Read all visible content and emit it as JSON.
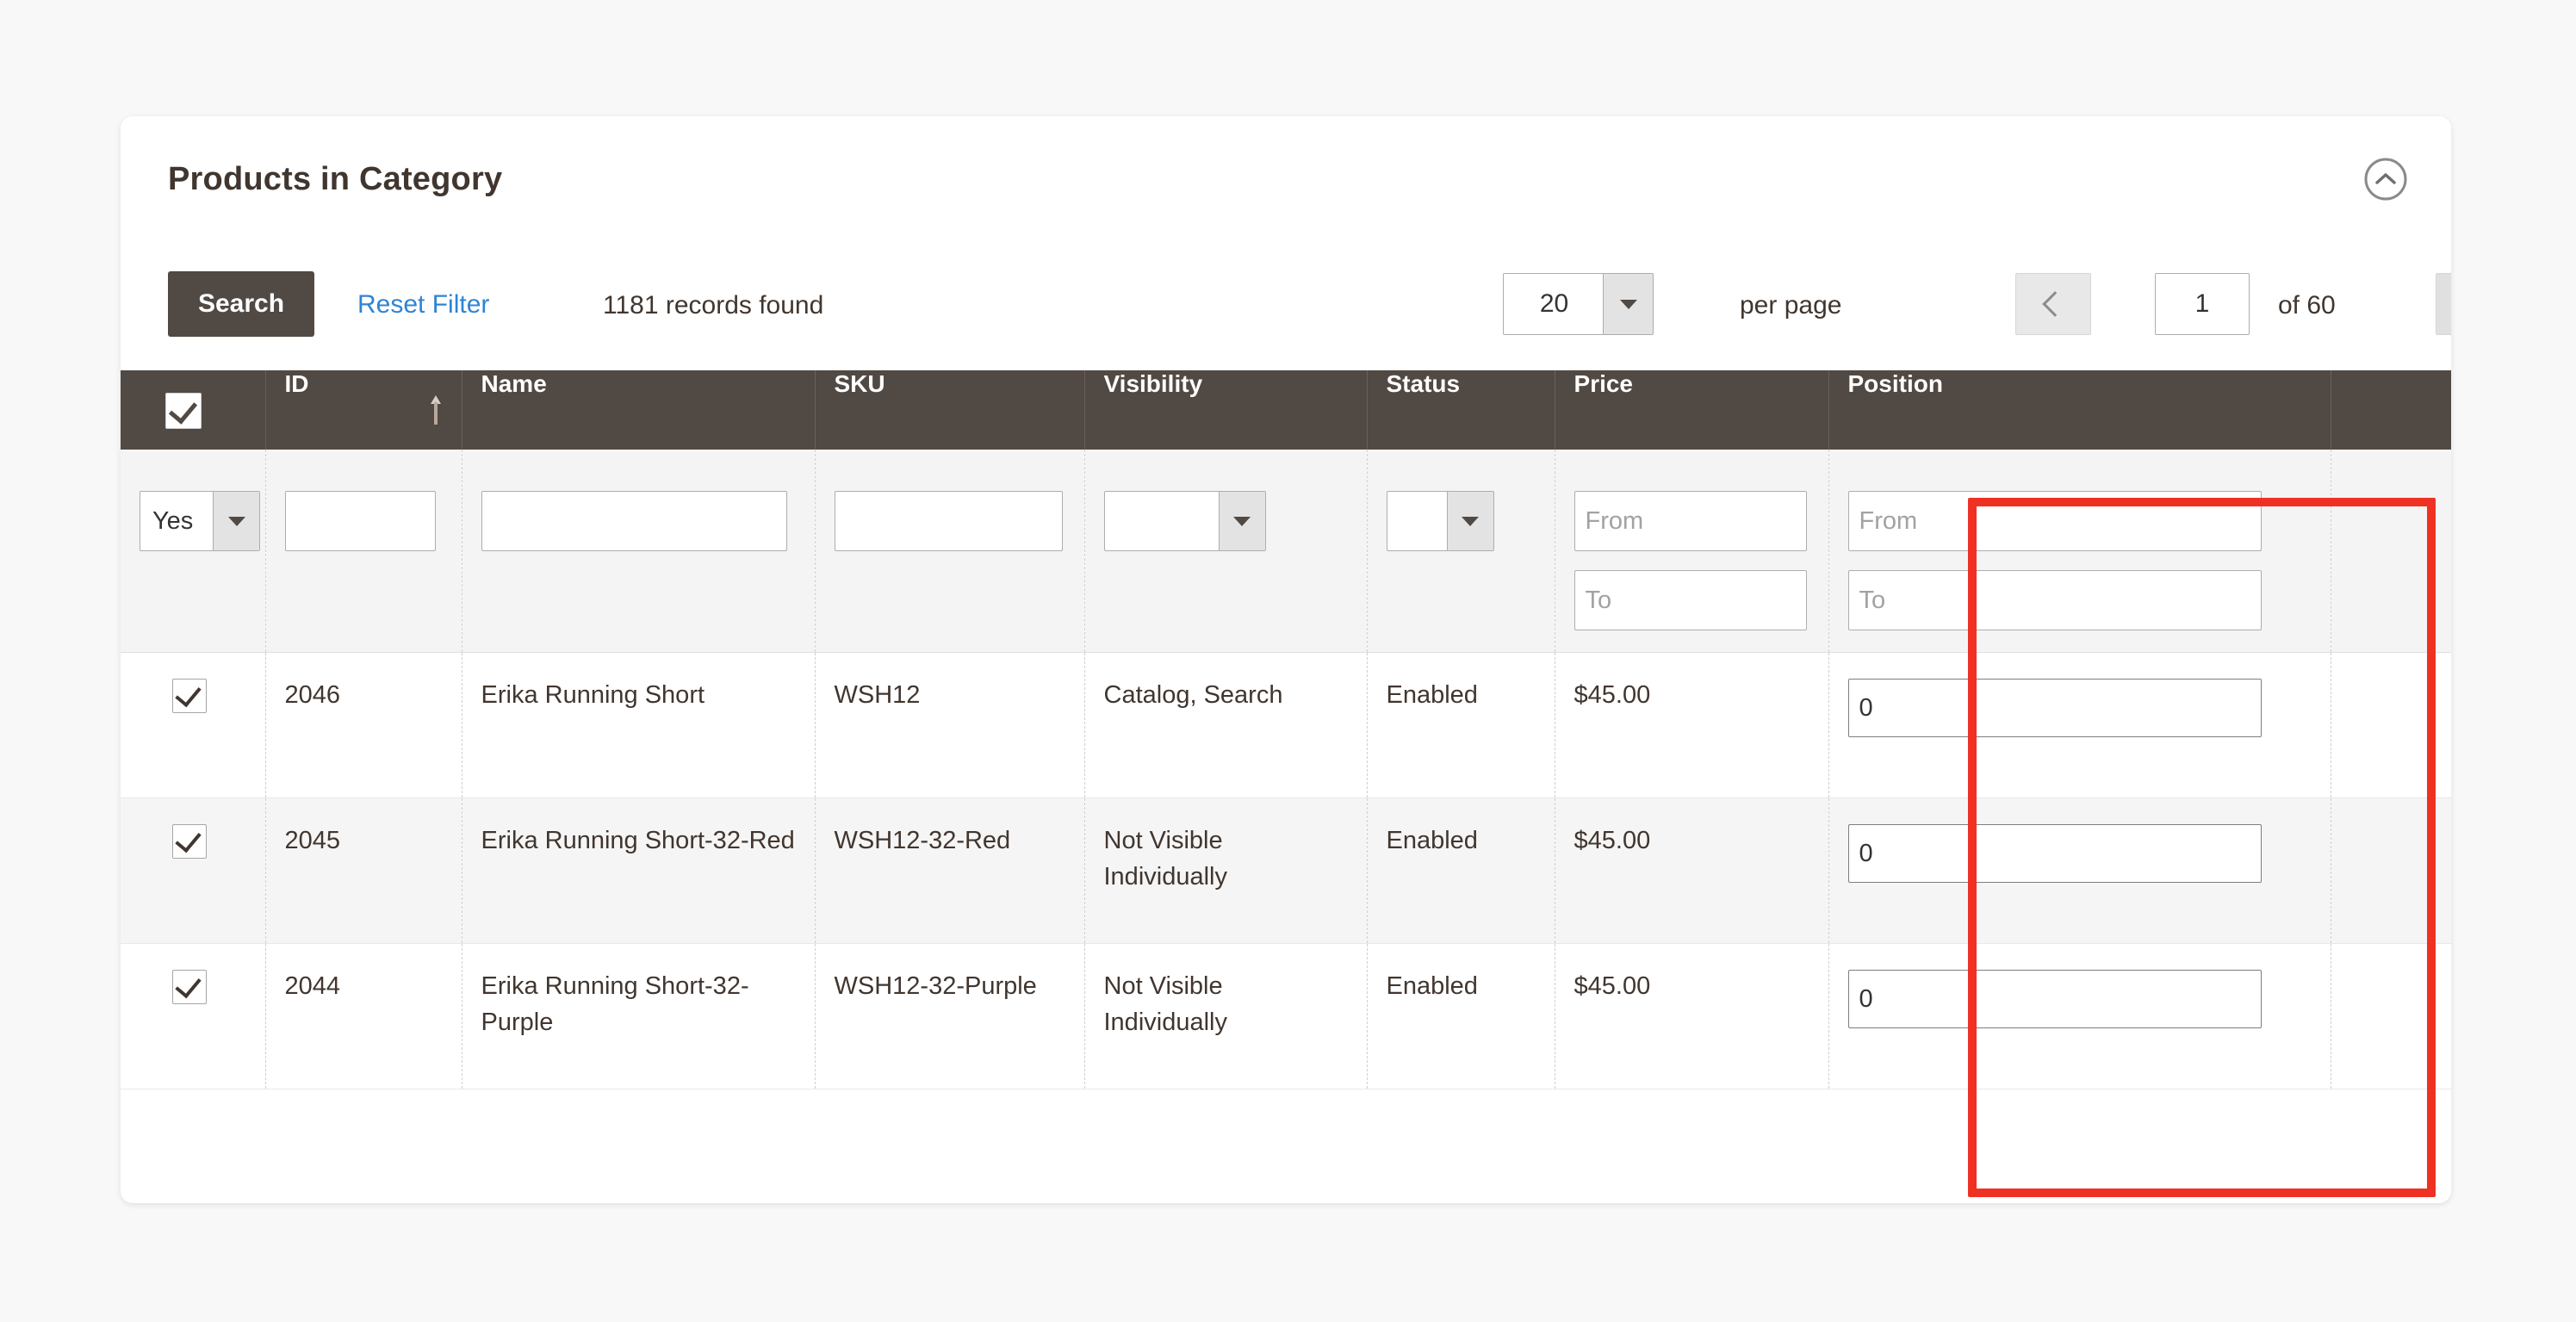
{
  "card": {
    "title": "Products in Category",
    "collapse_icon": "chevron-up-circle-icon"
  },
  "toolbar": {
    "search_label": "Search",
    "reset_filter_label": "Reset Filter",
    "records_found": "1181 records found",
    "per_page_value": "20",
    "per_page_label": "per page",
    "prev_icon": "chevron-left-icon",
    "next_icon": "chevron-right-icon",
    "page_value": "1",
    "of_total": "of 60"
  },
  "grid": {
    "select_all_checked": true,
    "columns": [
      {
        "key": "checkbox",
        "label": ""
      },
      {
        "key": "id",
        "label": "ID",
        "sort": "asc"
      },
      {
        "key": "name",
        "label": "Name"
      },
      {
        "key": "sku",
        "label": "SKU"
      },
      {
        "key": "visibility",
        "label": "Visibility"
      },
      {
        "key": "status",
        "label": "Status"
      },
      {
        "key": "price",
        "label": "Price"
      },
      {
        "key": "position",
        "label": "Position"
      }
    ],
    "filters": {
      "in_category_value": "Yes",
      "id_value": "",
      "name_value": "",
      "sku_value": "",
      "visibility_value": "",
      "status_value": "",
      "price_from_placeholder": "From",
      "price_to_placeholder": "To",
      "position_from_placeholder": "From",
      "position_to_placeholder": "To"
    },
    "rows": [
      {
        "checked": true,
        "id": "2046",
        "name": "Erika Running Short",
        "sku": "WSH12",
        "visibility": "Catalog, Search",
        "status": "Enabled",
        "price": "$45.00",
        "position": "0"
      },
      {
        "checked": true,
        "id": "2045",
        "name": "Erika Running Short-32-Red",
        "sku": "WSH12-32-Red",
        "visibility": "Not Visible Individually",
        "status": "Enabled",
        "price": "$45.00",
        "position": "0"
      },
      {
        "checked": true,
        "id": "2044",
        "name": "Erika Running Short-32-Purple",
        "sku": "WSH12-32-Purple",
        "visibility": "Not Visible Individually",
        "status": "Enabled",
        "price": "$45.00",
        "position": "0"
      }
    ]
  },
  "annotation": {
    "highlight_color": "#ef3124",
    "highlight_target": "position-column"
  },
  "colors": {
    "header_bg": "#514943",
    "link": "#2f84d3",
    "page_bg": "#f8f8f8",
    "card_bg": "#ffffff",
    "filter_row_bg": "#f4f4f4",
    "alt_row_bg": "#f5f5f5"
  }
}
